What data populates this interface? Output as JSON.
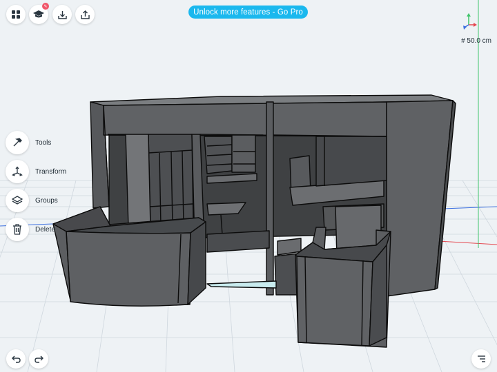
{
  "top_bar": {
    "menu_icon": "grid-icon",
    "learn_icon": "graduation-cap-icon",
    "learn_badge": "✎",
    "import_icon": "download-icon",
    "share_icon": "share-icon",
    "pro_banner": "Unlock more features - Go Pro"
  },
  "side_menu": {
    "items": [
      {
        "label": "Tools",
        "icon": "hammer-icon"
      },
      {
        "label": "Transform",
        "icon": "transform-axes-icon"
      },
      {
        "label": "Groups",
        "icon": "layers-icon"
      },
      {
        "label": "Delete",
        "icon": "trash-icon"
      }
    ]
  },
  "viewport": {
    "grid_size": "# 50.0 cm",
    "axis_colors": {
      "x": "#e4464e",
      "y": "#3fc46a",
      "z": "#3c6fe0"
    }
  },
  "bottom_bar": {
    "undo_icon": "undo-icon",
    "redo_icon": "redo-icon",
    "settings_icon": "sliders-icon"
  },
  "colors": {
    "accent": "#1ab8ee",
    "background": "#eef2f5",
    "model_face": "#5e6063",
    "model_edge": "#0c0c0c"
  }
}
